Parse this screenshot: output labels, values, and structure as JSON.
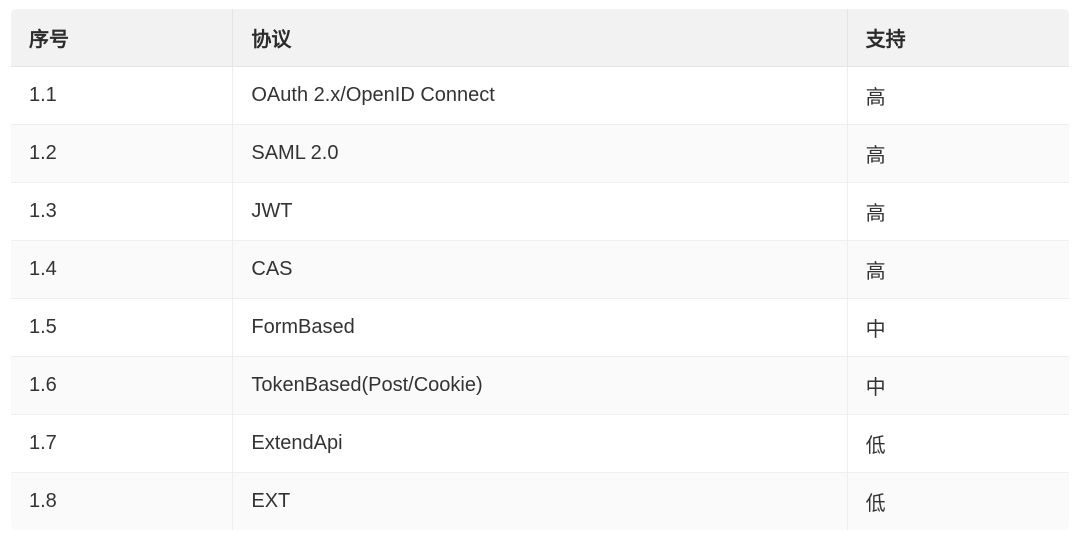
{
  "table": {
    "headers": {
      "seq": "序号",
      "protocol": "协议",
      "support": "支持"
    },
    "rows": [
      {
        "seq": "1.1",
        "protocol": "OAuth 2.x/OpenID Connect",
        "support": "高"
      },
      {
        "seq": "1.2",
        "protocol": "SAML 2.0",
        "support": "高"
      },
      {
        "seq": "1.3",
        "protocol": "JWT",
        "support": "高"
      },
      {
        "seq": "1.4",
        "protocol": "CAS",
        "support": "高"
      },
      {
        "seq": "1.5",
        "protocol": "FormBased",
        "support": "中"
      },
      {
        "seq": "1.6",
        "protocol": "TokenBased(Post/Cookie)",
        "support": "中"
      },
      {
        "seq": "1.7",
        "protocol": "ExtendApi",
        "support": "低"
      },
      {
        "seq": "1.8",
        "protocol": "EXT",
        "support": "低"
      }
    ]
  }
}
